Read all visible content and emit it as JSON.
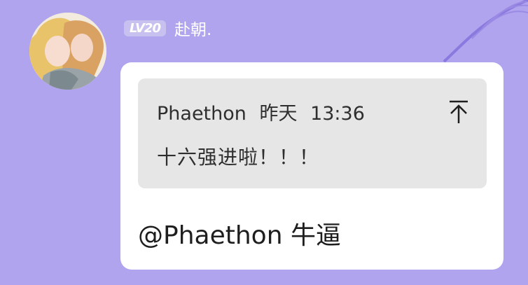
{
  "message": {
    "level_badge": "LV20",
    "sender_name": "赴朝.",
    "quote": {
      "author": "Phaethon",
      "day": "昨天",
      "time": "13:36",
      "text": "十六强进啦！！！"
    },
    "reply_text": "@Phaethon 牛逼"
  },
  "icons": {
    "jump": "jump-to-top-icon",
    "decoration": "feather-icon"
  },
  "colors": {
    "background": "#b0a4ee",
    "bubble": "#ffffff",
    "quote_box": "#e6e6e6",
    "level_badge": "#c6c1ee"
  }
}
